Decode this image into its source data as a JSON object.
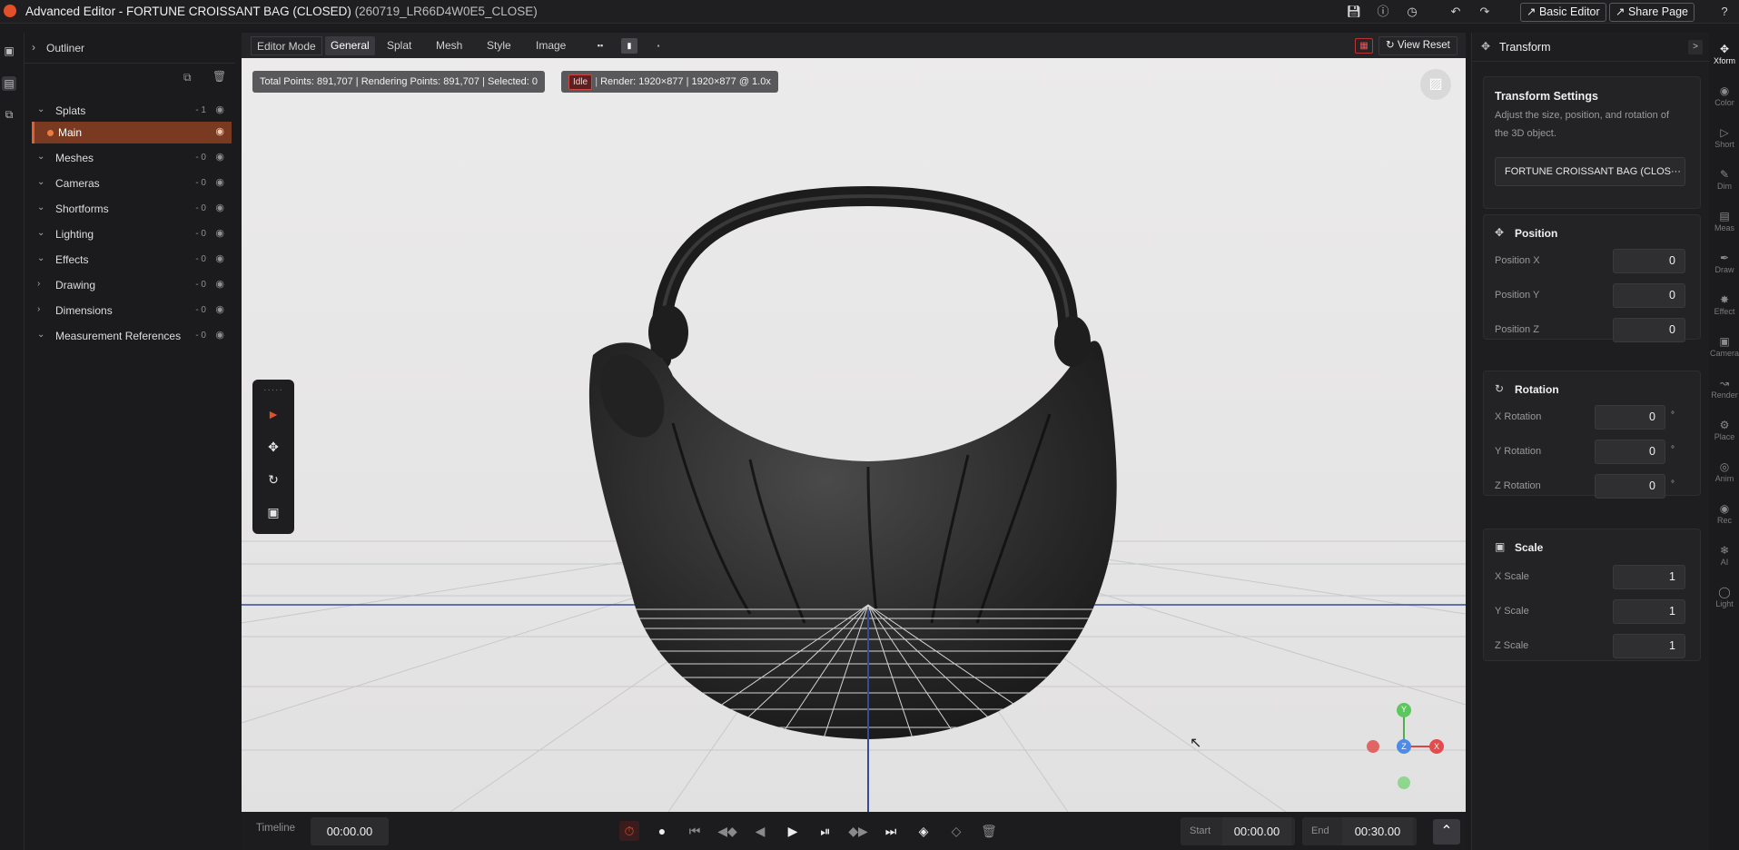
{
  "window": {
    "title": "Advanced Editor - FORTUNE CROISSANT BAG (CLOSED)",
    "title_suffix": "(260719_LR66D4W0E5_CLOSE)",
    "basic_editor_label": "Basic Editor",
    "share_page_label": "Share Page"
  },
  "outliner": {
    "title": "Outliner",
    "groups": [
      {
        "name": "Splats",
        "count": "- 1"
      },
      {
        "name": "Main",
        "count": ""
      },
      {
        "name": "Meshes",
        "count": "- 0"
      },
      {
        "name": "Cameras",
        "count": "- 0"
      },
      {
        "name": "Shortforms",
        "count": "- 0"
      },
      {
        "name": "Lighting",
        "count": "- 0"
      },
      {
        "name": "Effects",
        "count": "- 0"
      },
      {
        "name": "Drawing",
        "count": "- 0"
      },
      {
        "name": "Dimensions",
        "count": "- 0"
      },
      {
        "name": "Measurement References",
        "count": "- 0"
      }
    ]
  },
  "viewport": {
    "tabs": [
      "Editor Mode",
      "General",
      "Splat",
      "Mesh",
      "Style",
      "Image"
    ],
    "view_reset_label": "View Reset",
    "stats": "Total Points: 891,707  |  Rendering Points: 891,707  |  Selected: 0",
    "status_badge": "Idle",
    "render_info": "Render: 1920×877  |  1920×877 @ 1.0x",
    "axes": {
      "x": "X",
      "y": "Y",
      "z": "Z"
    }
  },
  "timeline": {
    "label": "Timeline",
    "current_time": "00:00.00",
    "start_label": "Start",
    "start_time": "00:00.00",
    "end_label": "End",
    "end_time": "00:30.00"
  },
  "transform": {
    "header": "Transform",
    "settings_title": "Transform Settings",
    "settings_desc_1": "Adjust the size, position, and rotation of",
    "settings_desc_2": "the 3D object.",
    "object_name": "FORTUNE CROISSANT BAG (CLOS···",
    "position_title": "Position",
    "position": [
      {
        "label": "Position X",
        "value": "0"
      },
      {
        "label": "Position Y",
        "value": "0"
      },
      {
        "label": "Position Z",
        "value": "0"
      }
    ],
    "rotation_title": "Rotation",
    "rotation": [
      {
        "label": "X Rotation",
        "value": "0"
      },
      {
        "label": "Y Rotation",
        "value": "0"
      },
      {
        "label": "Z Rotation",
        "value": "0"
      }
    ],
    "degree": "°",
    "scale_title": "Scale",
    "scale": [
      {
        "label": "X Scale",
        "value": "1"
      },
      {
        "label": "Y Scale",
        "value": "1"
      },
      {
        "label": "Z Scale",
        "value": "1"
      }
    ]
  },
  "right_rail": [
    "Xform",
    "Color",
    "Short",
    "Dim",
    "Meas",
    "Draw",
    "Effect",
    "Camera",
    "Render",
    "Place",
    "Anim",
    "Rec",
    "AI",
    "Light"
  ],
  "colors": {
    "accent": "#e2602e",
    "selected_row": "#7a3a22",
    "grid_blue": "#3a4a9a"
  }
}
